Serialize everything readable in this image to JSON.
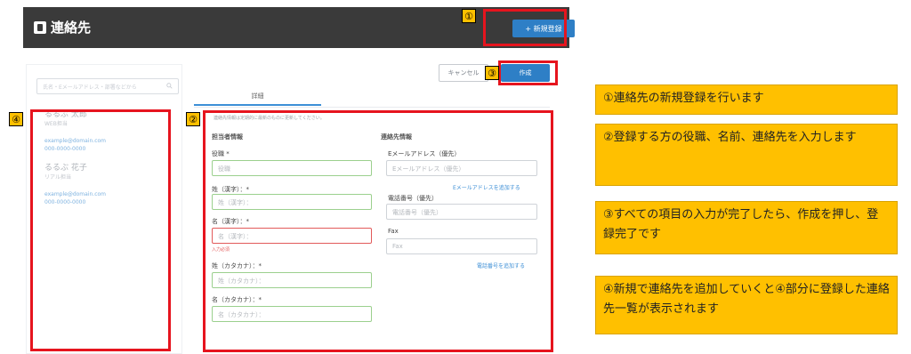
{
  "header": {
    "title": "連絡先",
    "new_button": "+ 新規登録"
  },
  "numbers": {
    "n1": "①",
    "n2": "②",
    "n3": "③",
    "n4": "④"
  },
  "list": {
    "search_placeholder": "氏名・Eメールアドレス・部署などから",
    "contacts": [
      {
        "name": "るるぶ 太郎",
        "role": "WEB担当",
        "email": "example@domain.com",
        "tel": "000-0000-0000"
      },
      {
        "name": "るるぶ 花子",
        "role": "リアル担当",
        "email": "example@domain.com",
        "tel": "000-0000-0000"
      }
    ]
  },
  "form": {
    "cancel": "キャンセル",
    "create": "作成",
    "tab": "詳細",
    "hint": "連絡先情報は定期的に最新のものに更新してください。",
    "person_section": "担当者情報",
    "contact_section": "連絡先情報",
    "role_label": "役職 *",
    "role_placeholder": "役職",
    "last_kanji_label": "姓（漢字）：*",
    "last_kanji_placeholder": "姓（漢字）：",
    "first_kanji_label": "名（漢字）：*",
    "first_kanji_placeholder": "名（漢字）：",
    "required_error": "入力必須",
    "last_kana_label": "姓（カタカナ）：*",
    "last_kana_placeholder": "姓（カタカナ）：",
    "first_kana_label": "名（カタカナ）：*",
    "first_kana_placeholder": "名（カタカナ）：",
    "email_label": "Eメールアドレス（優先）",
    "email_placeholder": "Eメールアドレス（優先）",
    "add_email": "Eメールアドレスを追加する",
    "phone_label": "電話番号（優先）",
    "phone_placeholder": "電話番号（優先）",
    "fax_label": "Fax",
    "fax_placeholder": "Fax",
    "add_phone": "電話番号を追加する"
  },
  "callouts": [
    "①連絡先の新規登録を行います",
    "②登録する方の役職、名前、連絡先を入力します",
    "③すべての項目の入力が完了したら、作成を押し、登録完了です",
    "④新規で連絡先を追加していくと④部分に登録した連絡先一覧が表示されます"
  ],
  "colors": {
    "annotation_red": "#e6141e",
    "callout_bg": "#ffc000",
    "primary": "#2e7fc6"
  }
}
